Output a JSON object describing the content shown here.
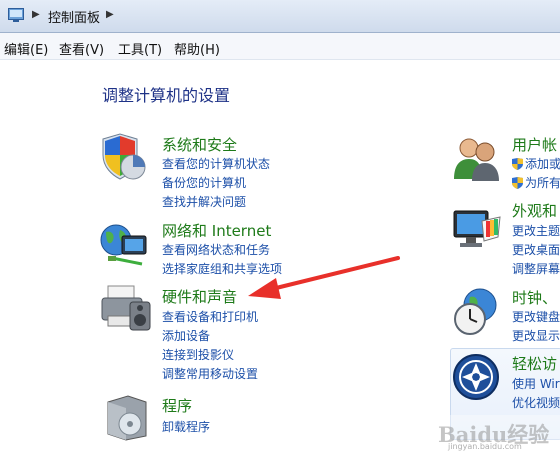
{
  "addressbar": {
    "path": "控制面板"
  },
  "menubar": {
    "items": [
      "编辑(E)",
      "查看(V)",
      "工具(T)",
      "帮助(H)"
    ]
  },
  "heading": "调整计算机的设置",
  "left_categories": [
    {
      "title": "系统和安全",
      "icon": "shield-pie-icon",
      "links": [
        "查看您的计算机状态",
        "备份您的计算机",
        "查找并解决问题"
      ]
    },
    {
      "title": "网络和 Internet",
      "icon": "network-globe-icon",
      "links": [
        "查看网络状态和任务",
        "选择家庭组和共享选项"
      ]
    },
    {
      "title": "硬件和声音",
      "icon": "printer-speaker-icon",
      "links": [
        "查看设备和打印机",
        "添加设备",
        "连接到投影仪",
        "调整常用移动设置"
      ]
    },
    {
      "title": "程序",
      "icon": "programs-box-icon",
      "links": [
        "卸载程序"
      ]
    }
  ],
  "right_categories": [
    {
      "title": "用户帐",
      "icon": "users-icon",
      "links": [
        "添加或",
        "为所有"
      ]
    },
    {
      "title": "外观和",
      "icon": "monitor-palette-icon",
      "links": [
        "更改主题",
        "更改桌面",
        "调整屏幕"
      ]
    },
    {
      "title": "时钟、",
      "icon": "clock-globe-icon",
      "links": [
        "更改键盘",
        "更改显示"
      ]
    },
    {
      "title": "轻松访",
      "icon": "ease-of-access-icon",
      "links": [
        "使用 Wir",
        "优化视频"
      ]
    }
  ],
  "watermark": {
    "brand": "Baidu经验",
    "url": "jingyan.baidu.com"
  },
  "colors": {
    "category_title": "#1e7a19",
    "link": "#1c4fa8",
    "heading": "#1e3287",
    "arrow": "#e8302a"
  }
}
